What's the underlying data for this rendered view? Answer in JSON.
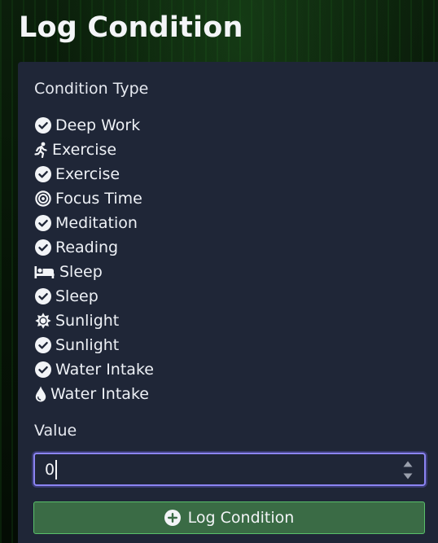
{
  "page": {
    "title": "Log Condition"
  },
  "form": {
    "type_label": "Condition Type",
    "condition_types": [
      {
        "label": "Deep Work",
        "icon": "check-circle-icon"
      },
      {
        "label": "Exercise",
        "icon": "running-icon"
      },
      {
        "label": "Exercise",
        "icon": "check-circle-icon"
      },
      {
        "label": "Focus Time",
        "icon": "target-icon"
      },
      {
        "label": "Meditation",
        "icon": "check-circle-icon"
      },
      {
        "label": "Reading",
        "icon": "check-circle-icon"
      },
      {
        "label": "Sleep",
        "icon": "bed-icon"
      },
      {
        "label": "Sleep",
        "icon": "check-circle-icon"
      },
      {
        "label": "Sunlight",
        "icon": "sun-icon"
      },
      {
        "label": "Sunlight",
        "icon": "check-circle-icon"
      },
      {
        "label": "Water Intake",
        "icon": "check-circle-icon"
      },
      {
        "label": "Water Intake",
        "icon": "droplet-icon"
      }
    ],
    "value_label": "Value",
    "value": "0",
    "submit_label": "Log Condition"
  },
  "colors": {
    "panel_bg": "#1f2637",
    "input_focus_border": "#8b84f2",
    "submit_bg": "#3a6b45",
    "submit_border": "#59c06a"
  }
}
